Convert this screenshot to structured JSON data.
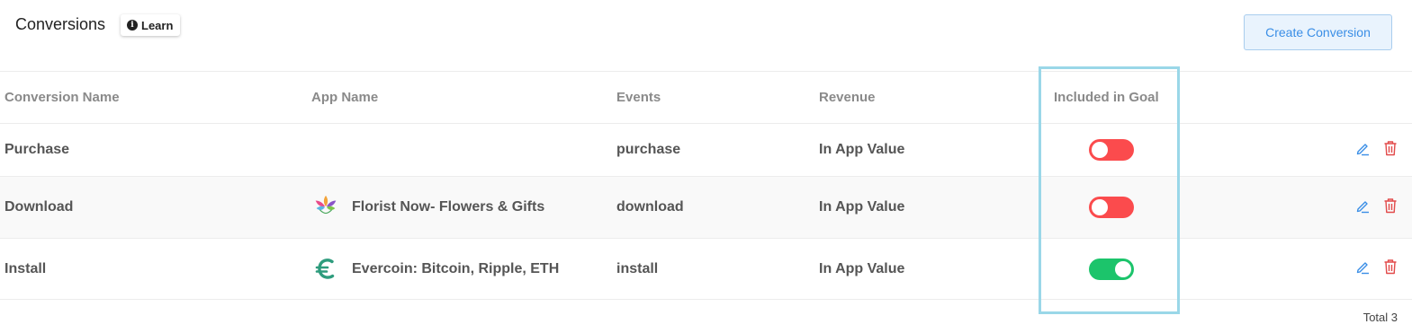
{
  "header": {
    "title": "Conversions",
    "learn_label": "Learn",
    "create_label": "Create Conversion"
  },
  "table": {
    "columns": [
      "Conversion Name",
      "App Name",
      "Events",
      "Revenue",
      "Included in Goal"
    ],
    "rows": [
      {
        "name": "Purchase",
        "app": "",
        "app_icon": "",
        "event": "purchase",
        "revenue": "In App Value",
        "included": false
      },
      {
        "name": "Download",
        "app": "Florist Now- Flowers & Gifts",
        "app_icon": "florist-now-logo",
        "app_icon_caption": "FLORIST NOW",
        "event": "download",
        "revenue": "In App Value",
        "included": false
      },
      {
        "name": "Install",
        "app": "Evercoin: Bitcoin, Ripple, ETH",
        "app_icon": "evercoin-logo",
        "event": "install",
        "revenue": "In App Value",
        "included": true
      }
    ],
    "total": "Total 3"
  },
  "colors": {
    "toggle_off": "#fb4b4d",
    "toggle_on": "#1cc46b",
    "highlight": "#9ad7e8",
    "edit_icon": "#3a8ee6",
    "delete_icon": "#e24a4a"
  }
}
